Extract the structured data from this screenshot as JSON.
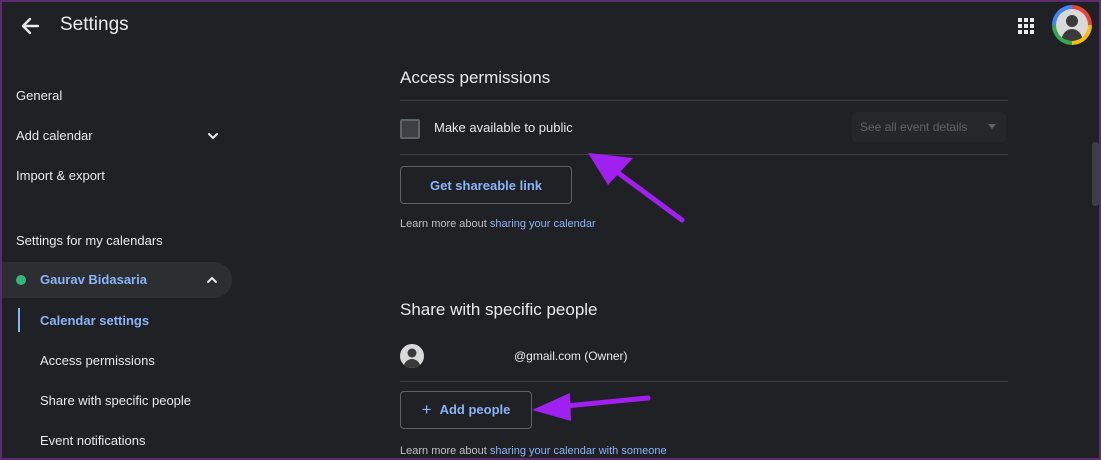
{
  "header": {
    "title": "Settings",
    "back_icon": "arrow-left-icon",
    "apps_icon": "apps-grid-icon",
    "avatar_icon": "account-avatar-icon"
  },
  "sidebar": {
    "general": "General",
    "add_calendar": "Add calendar",
    "import_export": "Import & export",
    "my_calendars_heading": "Settings for my calendars",
    "calendar_name": "Gaurav Bidasaria",
    "calendar_color": "#33b679",
    "sub_items": [
      "Calendar settings",
      "Access permissions",
      "Share with specific people",
      "Event notifications"
    ]
  },
  "access_permissions": {
    "title": "Access permissions",
    "checkbox_label": "Make available to public",
    "checkbox_checked": false,
    "visibility_select": "See all event details",
    "link_button": "Get shareable link",
    "learn_prefix": "Learn more about ",
    "learn_link": "sharing your calendar"
  },
  "share_people": {
    "title": "Share with specific people",
    "owner_email": "@gmail.com (Owner)",
    "add_button": "Add people",
    "learn_prefix": "Learn more about ",
    "learn_link": "sharing your calendar with someone"
  },
  "colors": {
    "background": "#202124",
    "accent_link": "#8ab4f8",
    "annotation_arrow": "#a020f0",
    "frame_border": "#5b2d6e"
  }
}
